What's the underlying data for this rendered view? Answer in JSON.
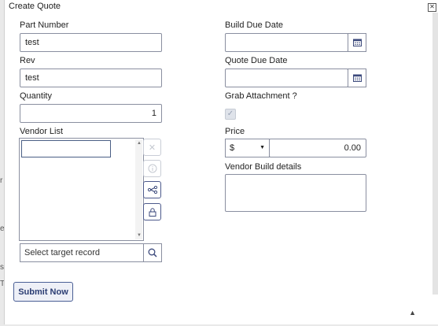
{
  "dialog": {
    "title": "Create Quote",
    "close_glyph": "✕"
  },
  "fields": {
    "part_number": {
      "label": "Part Number",
      "value": "test"
    },
    "rev": {
      "label": "Rev",
      "value": "test"
    },
    "quantity": {
      "label": "Quantity",
      "value": "1"
    },
    "vendor_list": {
      "label": "Vendor List"
    },
    "build_due_date": {
      "label": "Build Due Date",
      "value": ""
    },
    "quote_due_date": {
      "label": "Quote Due Date",
      "value": ""
    },
    "grab_attachment": {
      "label": "Grab Attachment ?",
      "checked": true
    },
    "price": {
      "label": "Price",
      "currency": "$",
      "value": "0.00"
    },
    "vendor_build_details": {
      "label": "Vendor Build details",
      "value": ""
    },
    "target_record": {
      "placeholder": "Select target record"
    }
  },
  "actions": {
    "submit_label": "Submit Now"
  },
  "colors": {
    "accent": "#2b3d73",
    "border": "#8a8fa0"
  },
  "background_hints": [
    "r",
    "e",
    "s",
    "T"
  ]
}
